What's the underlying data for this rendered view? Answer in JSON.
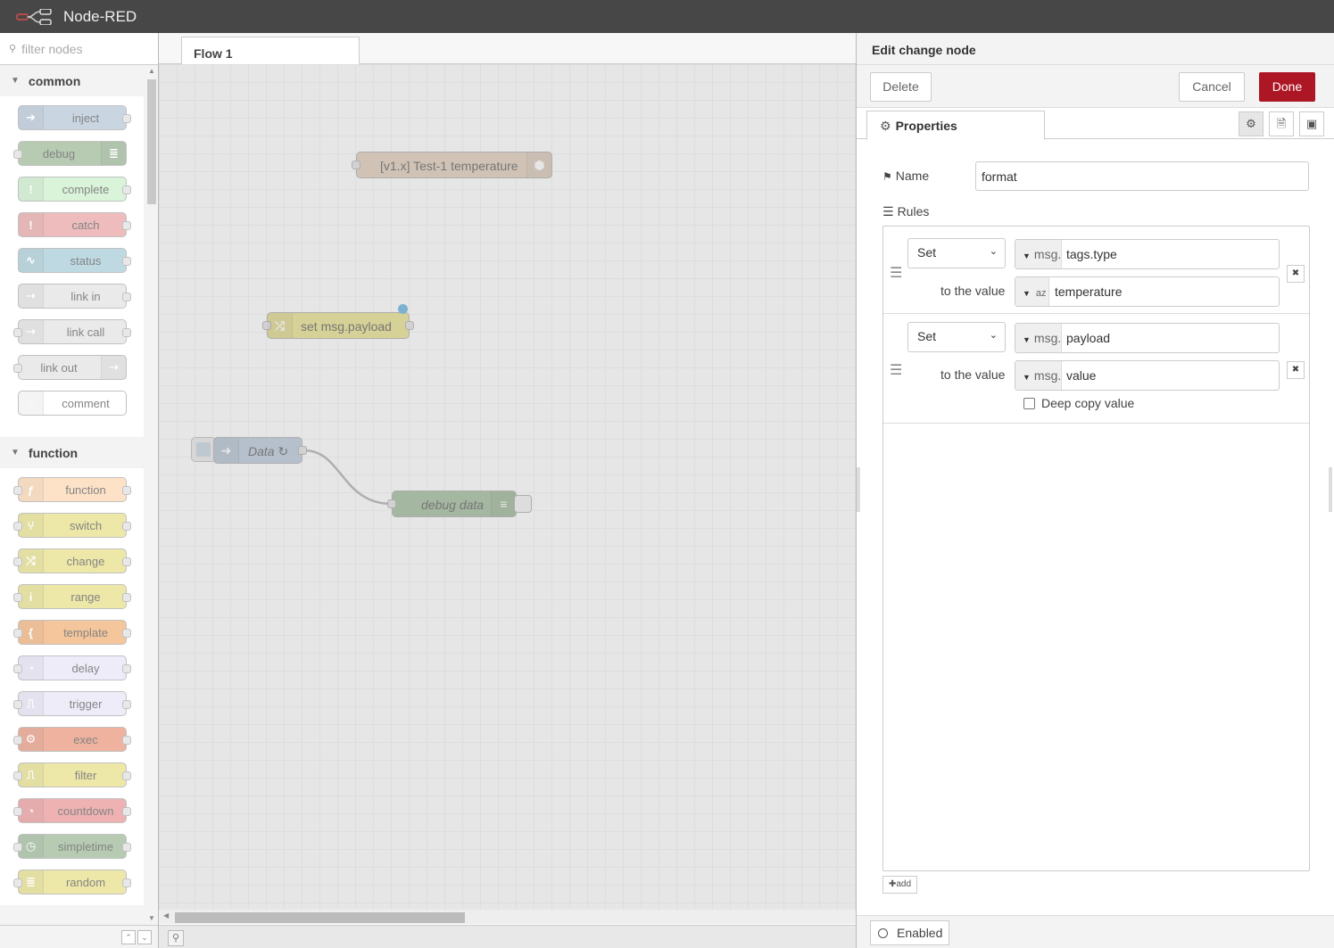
{
  "app": {
    "title": "Node-RED"
  },
  "palette": {
    "search_placeholder": "filter nodes",
    "categories": [
      {
        "name": "common",
        "nodes": [
          {
            "label": "inject",
            "color": "#a6bbcf",
            "icon": "arrow-right-icon"
          },
          {
            "label": "debug",
            "color": "#87a980",
            "icon": "list-icon",
            "out": true
          },
          {
            "label": "complete",
            "color": "#c0edc0",
            "icon": "exclamation-icon"
          },
          {
            "label": "catch",
            "color": "#e49191",
            "icon": "exclamation-icon"
          },
          {
            "label": "status",
            "color": "#94c1d0",
            "icon": "pulse-icon"
          },
          {
            "label": "link in",
            "color": "#dddddd",
            "icon": "link-icon"
          },
          {
            "label": "link call",
            "color": "#dddddd",
            "icon": "link-icon"
          },
          {
            "label": "link out",
            "color": "#dddddd",
            "icon": "link-icon",
            "out": true
          },
          {
            "label": "comment",
            "color": "#ffffff",
            "icon": "comment-icon"
          }
        ]
      },
      {
        "name": "function",
        "nodes": [
          {
            "label": "function",
            "color": "#fdd0a2",
            "icon": "function-icon"
          },
          {
            "label": "switch",
            "color": "#e2d96e",
            "icon": "switch-icon"
          },
          {
            "label": "change",
            "color": "#e2d96e",
            "icon": "shuffle-icon"
          },
          {
            "label": "range",
            "color": "#e2d96e",
            "icon": "range-icon"
          },
          {
            "label": "template",
            "color": "#f0a05a",
            "icon": "brace-icon"
          },
          {
            "label": "delay",
            "color": "#e6e0f8",
            "icon": "timer-icon"
          },
          {
            "label": "trigger",
            "color": "#e6e0f8",
            "icon": "trigger-icon"
          },
          {
            "label": "exec",
            "color": "#e47f5f",
            "icon": "cog-icon"
          },
          {
            "label": "filter",
            "color": "#e2d96e",
            "icon": "filter-icon"
          },
          {
            "label": "countdown",
            "color": "#e47f7f",
            "icon": "timer-icon"
          },
          {
            "label": "simpletime",
            "color": "#87a980",
            "icon": "clock-icon"
          },
          {
            "label": "random",
            "color": "#e2d96e",
            "icon": "list-icon"
          }
        ]
      }
    ]
  },
  "workspace": {
    "tab_label": "Flow 1",
    "nodes": [
      {
        "label": "[v1.x] Test-1 temperature",
        "color": "#d8bfa8"
      },
      {
        "label": "set msg.payload",
        "color": "#e2d96e"
      },
      {
        "label": "Data ↻",
        "color": "#a6bbcf"
      },
      {
        "label": "debug data",
        "color": "#87a980"
      }
    ]
  },
  "tray": {
    "title": "Edit change node",
    "delete_label": "Delete",
    "cancel_label": "Cancel",
    "done_label": "Done",
    "properties_tab": "Properties",
    "name_label": "Name",
    "name_value": "format",
    "rules_label": "Rules",
    "to_the_value": "to the value",
    "rules": [
      {
        "action": "Set",
        "target_type": "msg.",
        "target": "tags.type",
        "value_type": "az",
        "value": "temperature"
      },
      {
        "action": "Set",
        "target_type": "msg.",
        "target": "payload",
        "value_type": "msg.",
        "value": "value"
      }
    ],
    "deep_copy_label": "Deep copy value",
    "add_label": "add",
    "enabled_label": "Enabled"
  }
}
